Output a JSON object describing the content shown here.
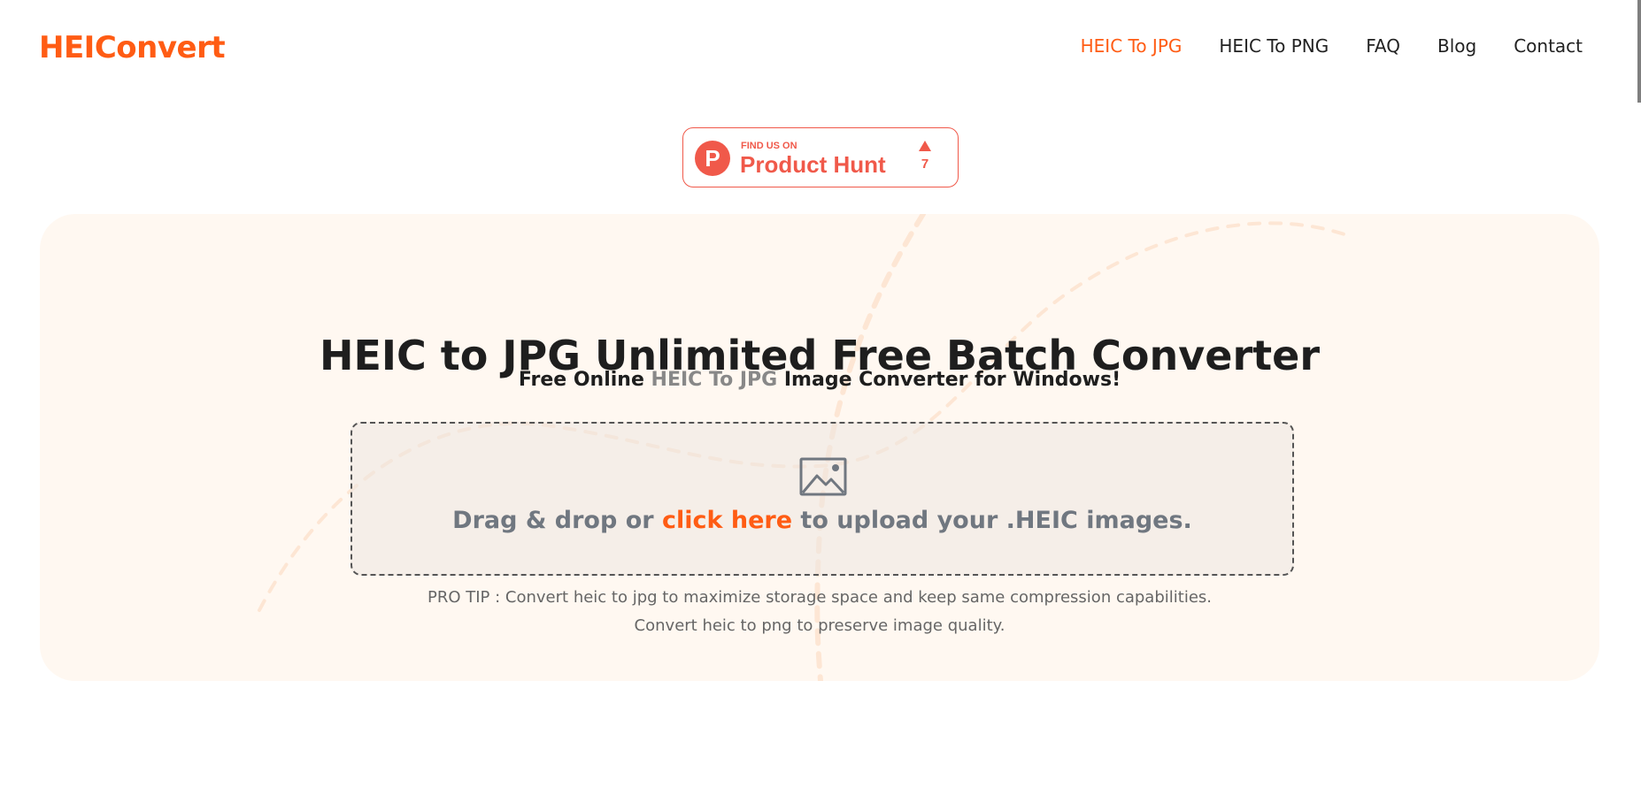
{
  "header": {
    "logo": "HEIConvert",
    "nav": [
      {
        "label": "HEIC To JPG",
        "active": true
      },
      {
        "label": "HEIC To PNG",
        "active": false
      },
      {
        "label": "FAQ",
        "active": false
      },
      {
        "label": "Blog",
        "active": false
      },
      {
        "label": "Contact",
        "active": false
      }
    ]
  },
  "product_hunt": {
    "logo_letter": "P",
    "small_text": "FIND US ON",
    "big_text": "Product Hunt",
    "upvote_count": "7"
  },
  "hero": {
    "title": "HEIC to JPG Unlimited Free Batch Converter",
    "subtitle_prefix": "Free Online ",
    "subtitle_highlight": "HEIC To JPG",
    "subtitle_suffix": " Image Converter for Windows!",
    "dropzone": {
      "icon": "image-icon",
      "text_prefix": "Drag & drop or ",
      "link_text": "click here",
      "text_suffix": " to upload your .HEIC images."
    },
    "pro_tip_line1": "PRO TIP : Convert heic to jpg to maximize storage space and keep same compression capabilities.",
    "pro_tip_line2": "Convert heic to png to preserve image quality."
  },
  "colors": {
    "brand": "#ff5c14",
    "product_hunt": "#f0594a",
    "hero_bg": "#fff8f1",
    "text_dark": "#1e1e1e"
  }
}
